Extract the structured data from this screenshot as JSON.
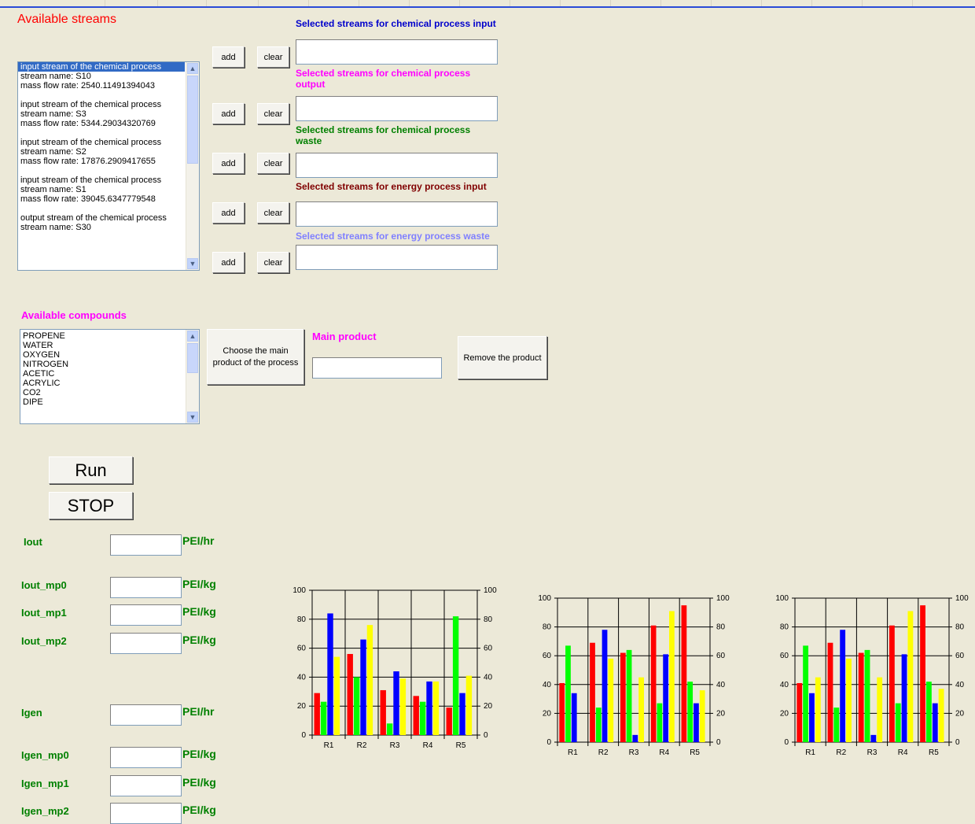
{
  "streams": {
    "title": "Available streams",
    "items": [
      "input stream of the chemical process",
      "stream name: S10",
      "mass flow rate: 2540.11491394043",
      "",
      "input stream of the chemical process",
      "stream name: S3",
      "mass flow rate: 5344.29034320769",
      "",
      "input stream of the chemical process",
      "stream name: S2",
      "mass flow rate: 17876.2909417655",
      "",
      "input stream of the chemical process",
      "stream name: S1",
      "mass flow rate: 39045.6347779548",
      "",
      "output stream of the chemical process",
      "stream name: S30"
    ]
  },
  "selected_groups": [
    {
      "title": "Selected streams for chemical process input",
      "color": "#0000cc",
      "add": "add",
      "clear": "clear",
      "value": ""
    },
    {
      "title": "Selected streams for chemical process output",
      "color": "#ff00ff",
      "add": "add",
      "clear": "clear",
      "value": ""
    },
    {
      "title": "Selected streams for chemical process waste",
      "color": "#008000",
      "add": "add",
      "clear": "clear",
      "value": ""
    },
    {
      "title": "Selected streams for energy process input",
      "color": "#800000",
      "add": "add",
      "clear": "clear",
      "value": ""
    },
    {
      "title": "Selected streams for energy process waste",
      "color": "#8080ff",
      "add": "add",
      "clear": "clear",
      "value": ""
    }
  ],
  "compounds": {
    "title": "Available compounds",
    "items": [
      "PROPENE",
      "WATER",
      "OXYGEN",
      "NITROGEN",
      "ACETIC",
      "ACRYLIC",
      "CO2",
      "DIPE"
    ]
  },
  "product": {
    "choose_label": "Choose the main product of the process",
    "main_label": "Main product",
    "value": "",
    "remove_label": "Remove the product"
  },
  "controls": {
    "run": "Run",
    "stop": "STOP"
  },
  "indices": [
    {
      "label": "Iout",
      "unit": "PEI/hr",
      "value": ""
    },
    {
      "label": "Iout_mp0",
      "unit": "PEI/kg",
      "value": ""
    },
    {
      "label": "Iout_mp1",
      "unit": "PEI/kg",
      "value": ""
    },
    {
      "label": "Iout_mp2",
      "unit": "PEI/kg",
      "value": ""
    },
    {
      "label": "Igen",
      "unit": "PEI/hr",
      "value": ""
    },
    {
      "label": "Igen_mp0",
      "unit": "PEI/kg",
      "value": ""
    },
    {
      "label": "Igen_mp1",
      "unit": "PEI/kg",
      "value": ""
    },
    {
      "label": "Igen_mp2",
      "unit": "PEI/kg",
      "value": ""
    }
  ],
  "colors": {
    "red": "#ff0000",
    "green": "#00ff00",
    "blue": "#0000ff",
    "yellow": "#ffff00"
  },
  "chart_data": [
    {
      "type": "bar",
      "categories": [
        "R1",
        "R2",
        "R3",
        "R4",
        "R5"
      ],
      "ylim": [
        0,
        100
      ],
      "yticks": [
        0,
        20,
        40,
        60,
        80,
        100
      ],
      "series": [
        {
          "color": "#ff0000",
          "values": [
            29,
            56,
            31,
            27,
            19
          ]
        },
        {
          "color": "#00ff00",
          "values": [
            23,
            40,
            8,
            23,
            82
          ]
        },
        {
          "color": "#0000ff",
          "values": [
            84,
            66,
            44,
            37,
            29
          ]
        },
        {
          "color": "#ffff00",
          "values": [
            54,
            76,
            39,
            37,
            41
          ]
        }
      ]
    },
    {
      "type": "bar",
      "categories": [
        "R1",
        "R2",
        "R3",
        "R4",
        "R5"
      ],
      "ylim": [
        0,
        100
      ],
      "yticks": [
        0,
        20,
        40,
        60,
        80,
        100
      ],
      "series": [
        {
          "color": "#ff0000",
          "values": [
            41,
            69,
            62,
            81,
            95
          ]
        },
        {
          "color": "#00ff00",
          "values": [
            67,
            24,
            64,
            27,
            42
          ]
        },
        {
          "color": "#0000ff",
          "values": [
            34,
            78,
            5,
            61,
            27
          ]
        },
        {
          "color": "#ffff00",
          "values": [
            0,
            58,
            45,
            91,
            36
          ]
        }
      ]
    },
    {
      "type": "bar",
      "categories": [
        "R1",
        "R2",
        "R3",
        "R4",
        "R5"
      ],
      "ylim": [
        0,
        100
      ],
      "yticks": [
        0,
        20,
        40,
        60,
        80,
        100
      ],
      "series": [
        {
          "color": "#ff0000",
          "values": [
            41,
            69,
            62,
            81,
            95
          ]
        },
        {
          "color": "#00ff00",
          "values": [
            67,
            24,
            64,
            27,
            42
          ]
        },
        {
          "color": "#0000ff",
          "values": [
            34,
            78,
            5,
            61,
            27
          ]
        },
        {
          "color": "#ffff00",
          "values": [
            45,
            58,
            45,
            91,
            37
          ]
        }
      ]
    }
  ]
}
